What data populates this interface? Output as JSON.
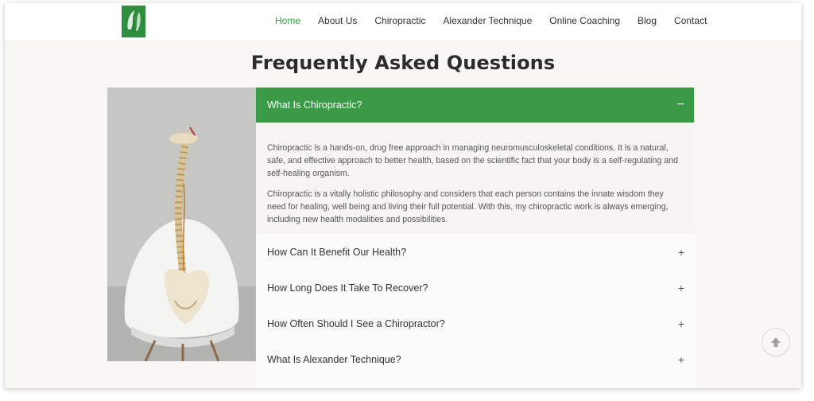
{
  "header": {
    "logo_icon": "leaf-logo",
    "nav": [
      {
        "label": "Home",
        "active": true
      },
      {
        "label": "About Us"
      },
      {
        "label": "Chiropractic"
      },
      {
        "label": "Alexander Technique"
      },
      {
        "label": "Online Coaching"
      },
      {
        "label": "Blog"
      },
      {
        "label": "Contact"
      }
    ]
  },
  "page": {
    "title": "Frequently Asked Questions",
    "image_subject": "spine-model-icon"
  },
  "faq": {
    "accent_color": "#3a9a45",
    "active": {
      "question": "What Is Chiropractic?",
      "toggle": "−",
      "answer": [
        "Chiropractic is a hands-on, drug free approach in managing neuromusculoskeletal conditions. It is a natural, safe, and effective approach to better health, based on the scientific fact that your body is a self-regulating and self-healing organism.",
        "Chiropractic is a vitally holistic philosophy and considers that each person contains the innate wisdom they need for healing, well being and living their full potential. With this, my chiropractic work is always emerging, including new health modalities and possibilities."
      ]
    },
    "items": [
      {
        "question": "How Can It Benefit Our Health?",
        "toggle": "+"
      },
      {
        "question": "How Long Does It Take To Recover?",
        "toggle": "+"
      },
      {
        "question": "How Often Should I See a Chiropractor?",
        "toggle": "+"
      },
      {
        "question": "What Is Alexander Technique?",
        "toggle": "+"
      }
    ]
  },
  "scroll_top": {
    "icon": "arrow-up-icon"
  }
}
